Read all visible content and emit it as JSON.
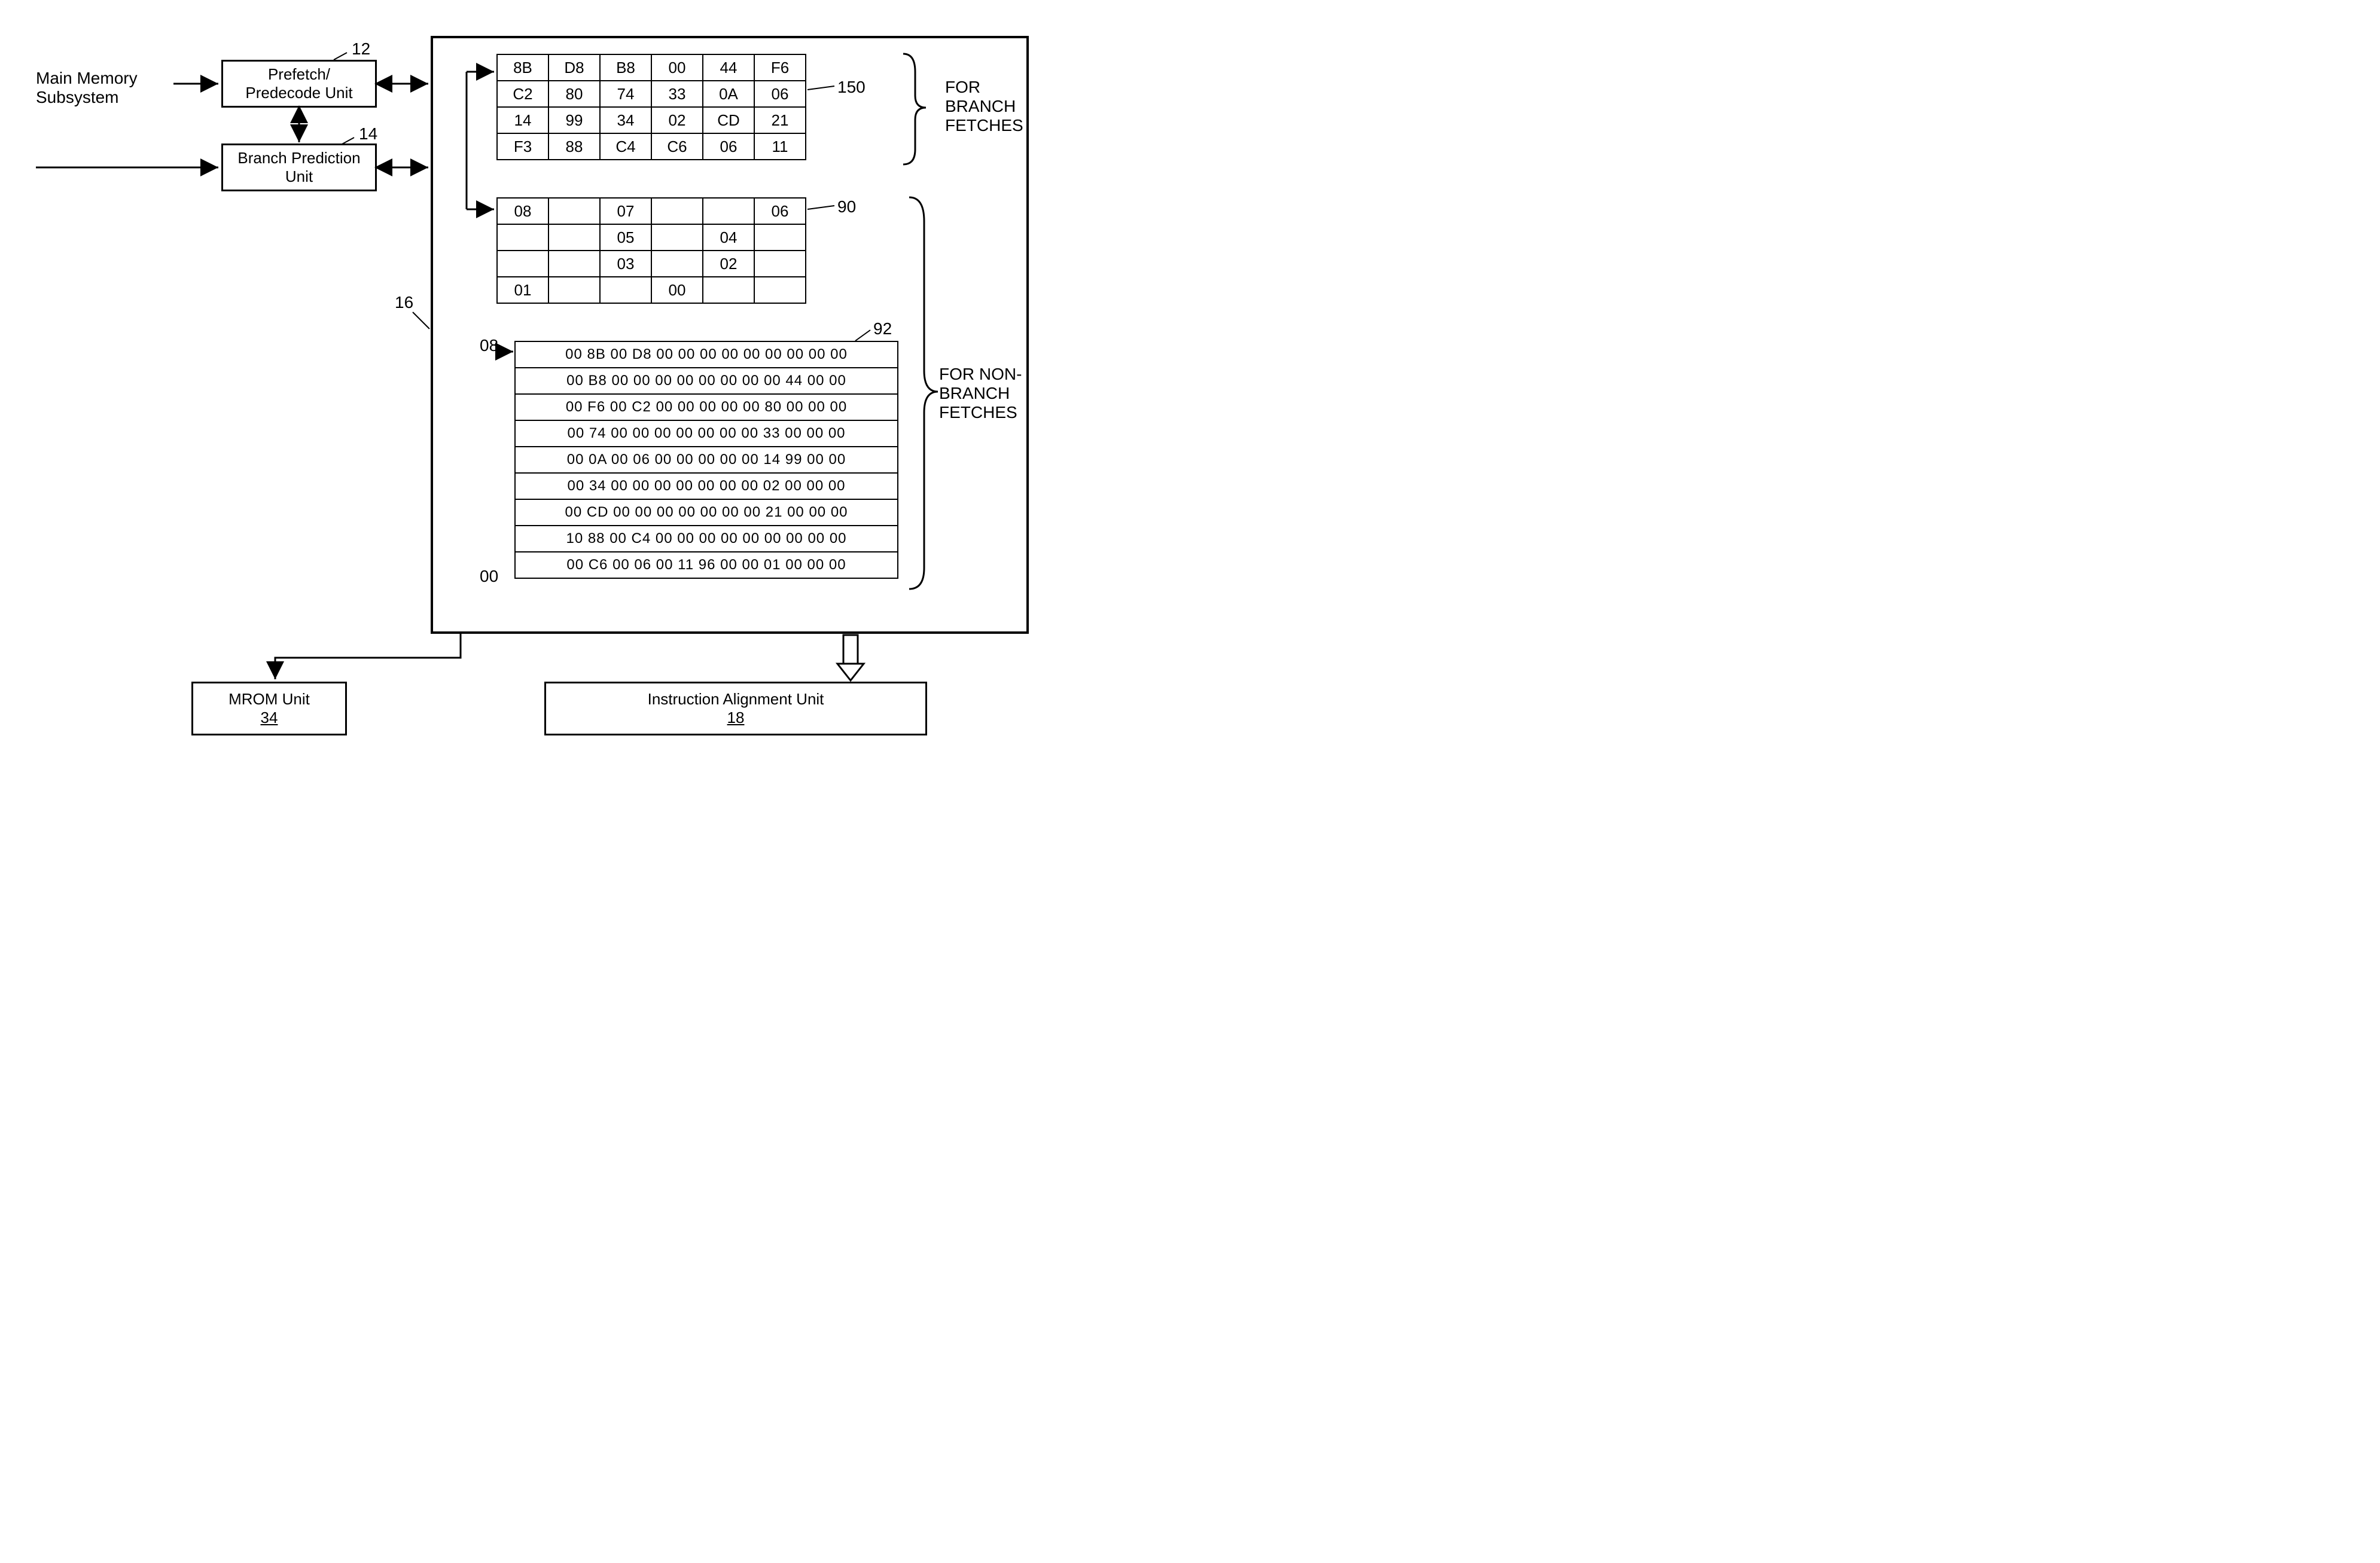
{
  "labels": {
    "main_memory": "Main Memory\nSubsystem",
    "prefetch": "Prefetch/\nPredecode Unit",
    "branch_pred": "Branch Prediction\nUnit",
    "mrom": "MROM Unit",
    "mrom_ref": "34",
    "ialign": "Instruction Alignment Unit",
    "ialign_ref": "18",
    "for_branch": "FOR\nBRANCH\nFETCHES",
    "for_nonbranch": "FOR NON-\nBRANCH\nFETCHES"
  },
  "refs": {
    "r12": "12",
    "r14": "14",
    "r16": "16",
    "r150": "150",
    "r90": "90",
    "r92": "92",
    "r08": "08",
    "r00": "00"
  },
  "table150": [
    [
      "8B",
      "D8",
      "B8",
      "00",
      "44",
      "F6"
    ],
    [
      "C2",
      "80",
      "74",
      "33",
      "0A",
      "06"
    ],
    [
      "14",
      "99",
      "34",
      "02",
      "CD",
      "21"
    ],
    [
      "F3",
      "88",
      "C4",
      "C6",
      "06",
      "11"
    ]
  ],
  "table90": [
    [
      "08",
      "",
      "07",
      "",
      "",
      "06"
    ],
    [
      "",
      "",
      "05",
      "",
      "04",
      ""
    ],
    [
      "",
      "",
      "03",
      "",
      "02",
      ""
    ],
    [
      "01",
      "",
      "",
      "00",
      "",
      ""
    ]
  ],
  "table92": [
    "00 8B 00 D8 00 00 00 00 00 00 00 00 00",
    "00 B8 00 00 00 00 00 00 00 00 44 00 00",
    "00 F6 00 C2 00 00 00 00 00 80 00 00 00",
    "00 74 00 00 00 00 00 00 00 33 00 00 00",
    "00 0A 00 06 00 00 00 00 00 14 99 00 00",
    "00 34 00 00 00 00 00 00 00 02  00 00 00",
    "00 CD 00 00 00 00 00 00 00 21 00 00 00",
    "10 88 00 C4 00 00 00 00 00 00 00 00 00",
    "00 C6 00 06 00 11 96 00 00 01 00 00 00"
  ]
}
